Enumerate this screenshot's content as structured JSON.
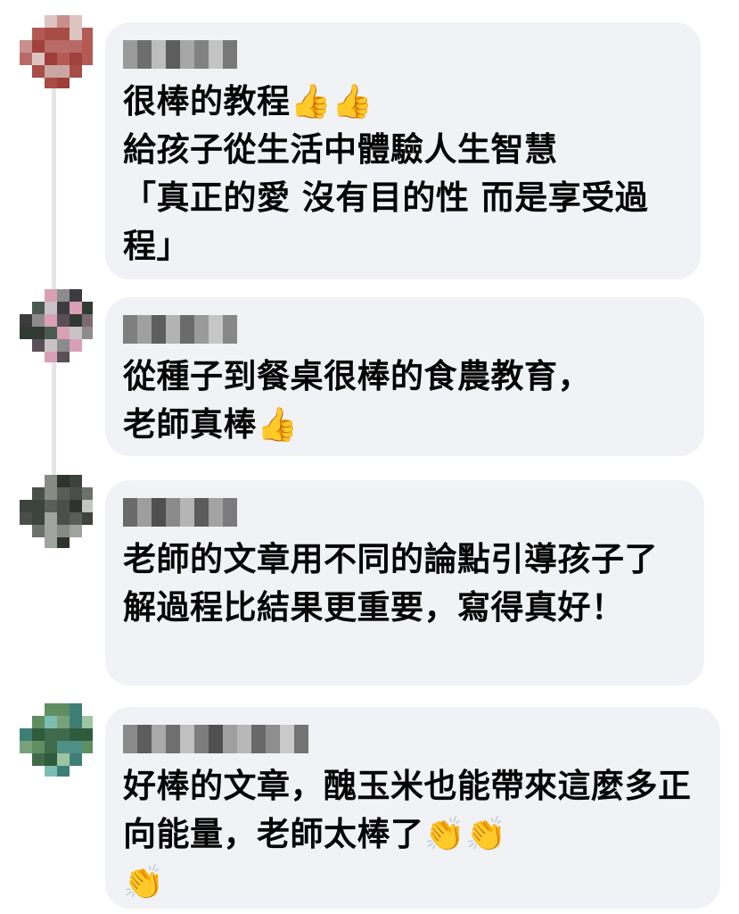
{
  "comments": [
    {
      "author": "",
      "text": "很棒的教程👍👍\n給孩子從生活中體驗人生智慧\n「真正的愛 沒有目的性 而是享受過程」"
    },
    {
      "author": "",
      "text": "從種子到餐桌很棒的食農教育，\n老師真棒👍"
    },
    {
      "author": "",
      "text": "老師的文章用不同的論點引導孩子了解過程比結果更重要，寫得真好！"
    },
    {
      "author": "",
      "text": "好棒的文章，醜玉米也能帶來這麼多正向能量，老師太棒了👏👏\n👏"
    }
  ],
  "colors": {
    "bubble_bg": "#f0f2f5",
    "text": "#050505",
    "thread_line": "#e4e5e8"
  }
}
